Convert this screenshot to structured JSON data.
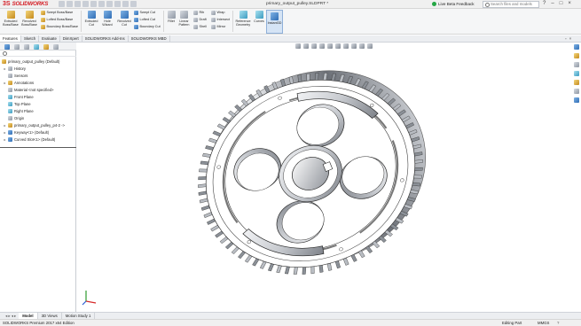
{
  "app": {
    "brand": "SOLIDWORKS",
    "title": "primary_output_pulley.SLDPRT *",
    "live_feedback": "Live Beta Feedback",
    "search_placeholder": "Search files and models"
  },
  "ribbon": {
    "extruded_boss": "Extruded\nBoss/Base",
    "revolved_boss": "Revolved\nBoss/Base",
    "swept_boss": "Swept Boss/Base",
    "lofted_boss": "Lofted Boss/Base",
    "boundary_boss": "Boundary Boss/Base",
    "extruded_cut": "Extruded\nCut",
    "hole_wizard": "Hole\nWizard",
    "revolved_cut": "Revolved\nCut",
    "swept_cut": "Swept Cut",
    "lofted_cut": "Lofted Cut",
    "boundary_cut": "Boundary Cut",
    "fillet": "Fillet",
    "linear_pattern": "Linear\nPattern",
    "rib": "Rib",
    "draft": "Draft",
    "shell": "Shell",
    "wrap": "Wrap",
    "intersect": "Intersect",
    "mirror": "Mirror",
    "reference_geometry": "Reference\nGeometry",
    "curves": "Curves",
    "instant3d": "Instant3D"
  },
  "command_tabs": [
    "Features",
    "Sketch",
    "Evaluate",
    "DimXpert",
    "SOLIDWORKS Add-Ins",
    "SOLIDWORKS MBD"
  ],
  "feature_tree": {
    "root": "primary_output_pulley  (Default)",
    "items": [
      {
        "label": "History",
        "expand": "▸"
      },
      {
        "label": "Sensors",
        "expand": ""
      },
      {
        "label": "Annotations",
        "expand": "▸"
      },
      {
        "label": "Material <not specified>",
        "expand": ""
      },
      {
        "label": "Front Plane",
        "expand": ""
      },
      {
        "label": "Top Plane",
        "expand": ""
      },
      {
        "label": "Right Plane",
        "expand": ""
      },
      {
        "label": "Origin",
        "expand": ""
      },
      {
        "label": "primary_output_pulley_p4-2 ->",
        "expand": "▸"
      },
      {
        "label": "Keyway<1> (Default)",
        "expand": "▸"
      },
      {
        "label": "Curved Slot<1> (Default)",
        "expand": "▸"
      }
    ]
  },
  "model_tabs": [
    "Model",
    "3D Views",
    "Motion Study 1"
  ],
  "status": {
    "edition": "SOLIDWORKS Premium 2017 x64 Edition",
    "mode": "Editing Part",
    "units": "MMGS",
    "help": "?"
  },
  "colors": {
    "brand_red": "#d41c24",
    "part_light": "#e4e6e9",
    "part_dark": "#6c7077",
    "feedback_green": "#25a745"
  },
  "model": {
    "type": "timing pulley gear",
    "tooth_count": 80,
    "lightening_holes": 4,
    "curved_slots": 2,
    "bolt_holes": 6
  }
}
